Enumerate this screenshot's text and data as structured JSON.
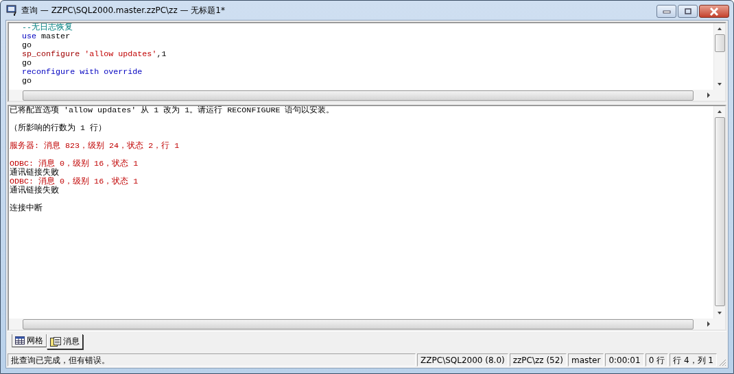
{
  "window": {
    "title": "查询 — ZZPC\\SQL2000.master.zzPC\\zz — 无标题1*"
  },
  "editor": {
    "lines": [
      [
        {
          "kind": "comment",
          "text": "--无日志恢复"
        }
      ],
      [
        {
          "kind": "keyword",
          "text": "use"
        },
        {
          "kind": "plain",
          "text": " master"
        }
      ],
      [
        {
          "kind": "plain",
          "text": "go"
        }
      ],
      [
        {
          "kind": "proc",
          "text": "sp_configure"
        },
        {
          "kind": "string",
          "text": " 'allow updates'"
        },
        {
          "kind": "plain",
          "text": ",1"
        }
      ],
      [
        {
          "kind": "plain",
          "text": "go"
        }
      ],
      [
        {
          "kind": "keyword",
          "text": "reconfigure"
        },
        {
          "kind": "keyword",
          "text": " with"
        },
        {
          "kind": "keyword",
          "text": " override"
        }
      ],
      [
        {
          "kind": "plain",
          "text": "go"
        }
      ]
    ]
  },
  "messages": [
    {
      "kind": "normal",
      "gap_before": false,
      "text": "已将配置选项 'allow updates' 从 1 改为 1。请运行 RECONFIGURE 语句以安装。"
    },
    {
      "kind": "normal",
      "gap_before": true,
      "text": "（所影响的行数为 1 行）"
    },
    {
      "kind": "error",
      "gap_before": true,
      "text": "服务器: 消息 823，级别 24，状态 2，行 1"
    },
    {
      "kind": "error",
      "gap_before": true,
      "text": "ODBC: 消息 0，级别 16，状态 1"
    },
    {
      "kind": "normal",
      "gap_before": false,
      "text": "通讯链接失败"
    },
    {
      "kind": "error",
      "gap_before": false,
      "text": "ODBC: 消息 0，级别 16，状态 1"
    },
    {
      "kind": "normal",
      "gap_before": false,
      "text": "通讯链接失败"
    },
    {
      "kind": "normal",
      "gap_before": true,
      "text": "连接中断"
    }
  ],
  "tabs": [
    {
      "kind": "grid",
      "label": "网格",
      "selected": false
    },
    {
      "kind": "messages",
      "label": "消息",
      "selected": true
    }
  ],
  "status_bar": {
    "message": "批查询已完成，但有错误。",
    "panels": [
      "ZZPC\\SQL2000 (8.0)",
      "zzPC\\zz (52)",
      "master",
      "0:00:01",
      "0 行",
      "行 4，列 1"
    ]
  }
}
